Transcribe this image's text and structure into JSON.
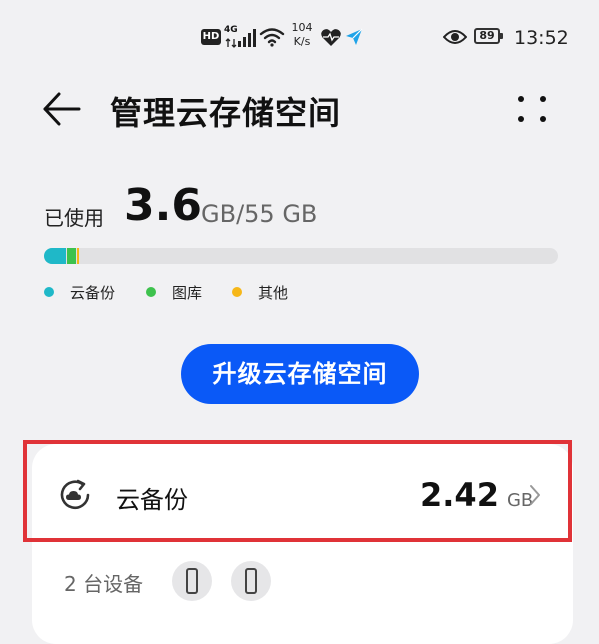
{
  "status_bar": {
    "hd_badge": "HD",
    "network_gen": "4G",
    "net_speed_value": "104",
    "net_speed_unit": "K/s",
    "battery_level": "89",
    "time": "13:52",
    "icons": [
      "signal-icon",
      "wifi-icon",
      "heart-rate-icon",
      "send-icon",
      "eye-icon",
      "battery-icon"
    ]
  },
  "header": {
    "title": "管理云存储空间",
    "back_icon": "arrow-left-icon",
    "more_icon": "more-dots-icon"
  },
  "storage": {
    "used_label": "已使用",
    "used_value": "3.6",
    "total_text": "GB/55 GB",
    "usage_fraction": 0.065,
    "segments": [
      {
        "name": "云备份",
        "color": "#1fb8c8",
        "fraction": 0.043
      },
      {
        "name": "图库",
        "color": "#3ec24d",
        "fraction": 0.017
      },
      {
        "name": "其他",
        "color": "#f6b718",
        "fraction": 0.004
      }
    ],
    "legend": [
      {
        "label": "云备份",
        "color": "#1fb8c8"
      },
      {
        "label": "图库",
        "color": "#3ec24d"
      },
      {
        "label": "其他",
        "color": "#f6b718"
      }
    ]
  },
  "upgrade_button": {
    "label": "升级云存储空间",
    "color": "#0a59f7"
  },
  "cloud_backup": {
    "label": "云备份",
    "size_value": "2.42",
    "size_unit": "GB",
    "icon": "cloud-backup-icon",
    "highlight_color": "#e03338"
  },
  "devices": {
    "label": "2 台设备",
    "items": [
      "phone-icon",
      "phone-icon"
    ]
  }
}
